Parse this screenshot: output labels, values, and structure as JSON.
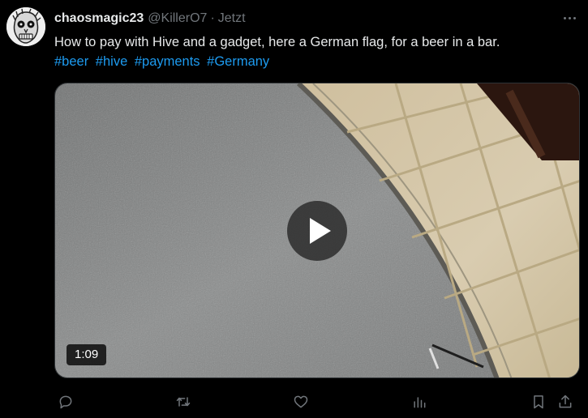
{
  "tweet": {
    "author_name": "chaosmagic23",
    "author_handle": "@KillerO7",
    "separator": "·",
    "time": "Jetzt",
    "text": "How to pay with Hive and a gadget, here a German flag, for a beer in a bar.",
    "hashtags": [
      "#beer",
      "#hive",
      "#payments",
      "#Germany"
    ]
  },
  "video": {
    "duration": "1:09"
  },
  "icons": {
    "avatar": "zombie-face-avatar",
    "more": "more-options-icon",
    "reply": "reply-icon",
    "retweet": "retweet-icon",
    "like": "like-icon",
    "views": "views-icon",
    "bookmark": "bookmark-icon",
    "share": "share-icon"
  },
  "colors": {
    "background": "#000000",
    "text": "#e7e9ea",
    "muted": "#71767b",
    "accent": "#1d9bf0"
  }
}
